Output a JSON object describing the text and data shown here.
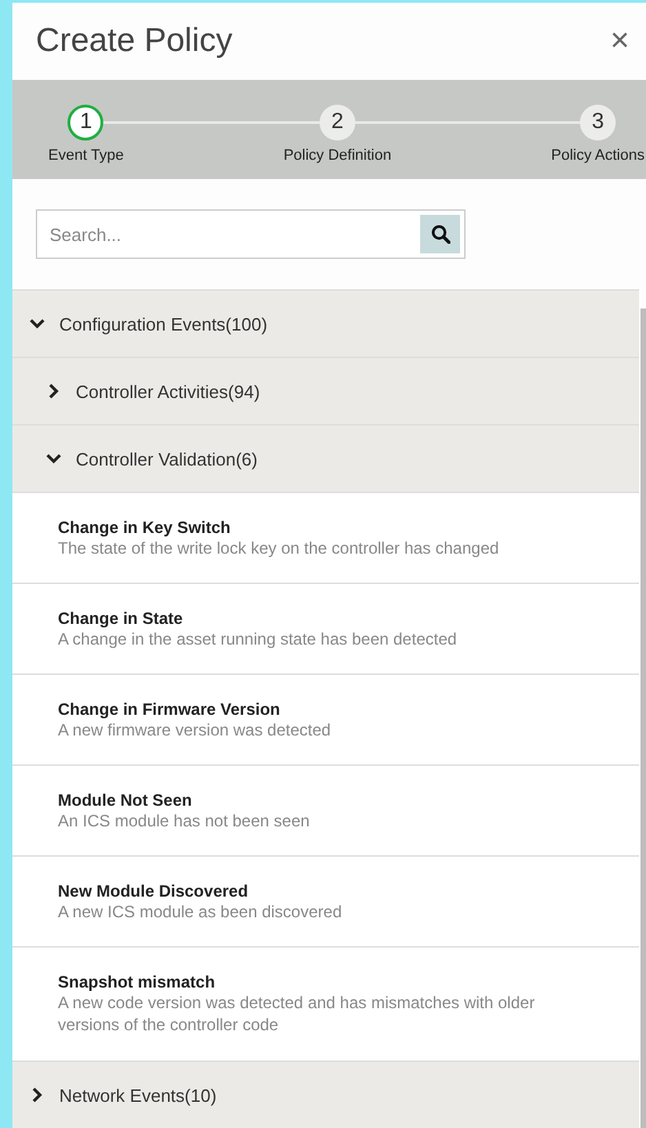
{
  "dialog": {
    "title": "Create Policy",
    "close": "×"
  },
  "steps": [
    {
      "number": "1",
      "label": "Event Type",
      "selected": true
    },
    {
      "number": "2",
      "label": "Policy Definition",
      "selected": false
    },
    {
      "number": "3",
      "label": "Policy Actions",
      "selected": false
    }
  ],
  "search": {
    "placeholder": "Search..."
  },
  "tree": [
    {
      "label": "Configuration Events(100)",
      "expanded": true,
      "children": [
        {
          "label": "Controller Activities(94)",
          "expanded": false
        },
        {
          "label": "Controller Validation(6)",
          "expanded": true,
          "events": [
            {
              "title": "Change in Key Switch",
              "description": "The state of the write lock key on the controller has changed"
            },
            {
              "title": "Change in State",
              "description": "A change in the asset running state has been detected"
            },
            {
              "title": "Change in Firmware Version",
              "description": "A new firmware version was detected"
            },
            {
              "title": "Module Not Seen",
              "description": "An ICS module has not been seen"
            },
            {
              "title": "New Module Discovered",
              "description": "A new ICS module as been discovered"
            },
            {
              "title": "Snapshot mismatch",
              "description": "A new code version was detected and has mismatches with older versions of the controller code"
            }
          ]
        }
      ]
    },
    {
      "label": "Network Events(10)",
      "expanded": false
    }
  ]
}
